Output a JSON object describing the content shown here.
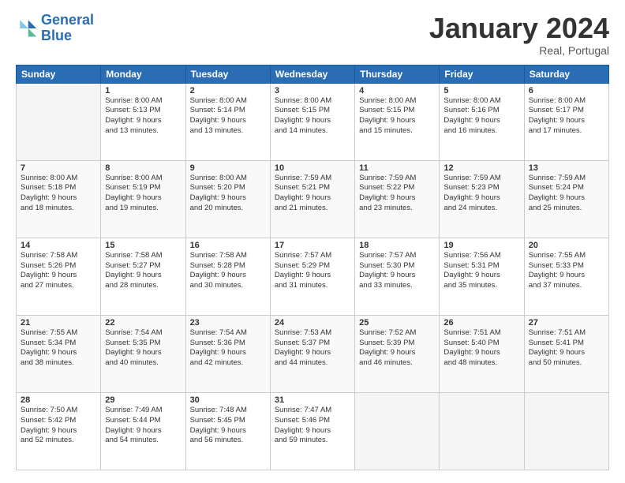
{
  "logo": {
    "line1": "General",
    "line2": "Blue"
  },
  "header": {
    "month": "January 2024",
    "location": "Real, Portugal"
  },
  "weekdays": [
    "Sunday",
    "Monday",
    "Tuesday",
    "Wednesday",
    "Thursday",
    "Friday",
    "Saturday"
  ],
  "weeks": [
    [
      {
        "day": "",
        "info": ""
      },
      {
        "day": "1",
        "info": "Sunrise: 8:00 AM\nSunset: 5:13 PM\nDaylight: 9 hours\nand 13 minutes."
      },
      {
        "day": "2",
        "info": "Sunrise: 8:00 AM\nSunset: 5:14 PM\nDaylight: 9 hours\nand 13 minutes."
      },
      {
        "day": "3",
        "info": "Sunrise: 8:00 AM\nSunset: 5:15 PM\nDaylight: 9 hours\nand 14 minutes."
      },
      {
        "day": "4",
        "info": "Sunrise: 8:00 AM\nSunset: 5:15 PM\nDaylight: 9 hours\nand 15 minutes."
      },
      {
        "day": "5",
        "info": "Sunrise: 8:00 AM\nSunset: 5:16 PM\nDaylight: 9 hours\nand 16 minutes."
      },
      {
        "day": "6",
        "info": "Sunrise: 8:00 AM\nSunset: 5:17 PM\nDaylight: 9 hours\nand 17 minutes."
      }
    ],
    [
      {
        "day": "7",
        "info": "Sunrise: 8:00 AM\nSunset: 5:18 PM\nDaylight: 9 hours\nand 18 minutes."
      },
      {
        "day": "8",
        "info": "Sunrise: 8:00 AM\nSunset: 5:19 PM\nDaylight: 9 hours\nand 19 minutes."
      },
      {
        "day": "9",
        "info": "Sunrise: 8:00 AM\nSunset: 5:20 PM\nDaylight: 9 hours\nand 20 minutes."
      },
      {
        "day": "10",
        "info": "Sunrise: 7:59 AM\nSunset: 5:21 PM\nDaylight: 9 hours\nand 21 minutes."
      },
      {
        "day": "11",
        "info": "Sunrise: 7:59 AM\nSunset: 5:22 PM\nDaylight: 9 hours\nand 23 minutes."
      },
      {
        "day": "12",
        "info": "Sunrise: 7:59 AM\nSunset: 5:23 PM\nDaylight: 9 hours\nand 24 minutes."
      },
      {
        "day": "13",
        "info": "Sunrise: 7:59 AM\nSunset: 5:24 PM\nDaylight: 9 hours\nand 25 minutes."
      }
    ],
    [
      {
        "day": "14",
        "info": "Sunrise: 7:58 AM\nSunset: 5:26 PM\nDaylight: 9 hours\nand 27 minutes."
      },
      {
        "day": "15",
        "info": "Sunrise: 7:58 AM\nSunset: 5:27 PM\nDaylight: 9 hours\nand 28 minutes."
      },
      {
        "day": "16",
        "info": "Sunrise: 7:58 AM\nSunset: 5:28 PM\nDaylight: 9 hours\nand 30 minutes."
      },
      {
        "day": "17",
        "info": "Sunrise: 7:57 AM\nSunset: 5:29 PM\nDaylight: 9 hours\nand 31 minutes."
      },
      {
        "day": "18",
        "info": "Sunrise: 7:57 AM\nSunset: 5:30 PM\nDaylight: 9 hours\nand 33 minutes."
      },
      {
        "day": "19",
        "info": "Sunrise: 7:56 AM\nSunset: 5:31 PM\nDaylight: 9 hours\nand 35 minutes."
      },
      {
        "day": "20",
        "info": "Sunrise: 7:55 AM\nSunset: 5:33 PM\nDaylight: 9 hours\nand 37 minutes."
      }
    ],
    [
      {
        "day": "21",
        "info": "Sunrise: 7:55 AM\nSunset: 5:34 PM\nDaylight: 9 hours\nand 38 minutes."
      },
      {
        "day": "22",
        "info": "Sunrise: 7:54 AM\nSunset: 5:35 PM\nDaylight: 9 hours\nand 40 minutes."
      },
      {
        "day": "23",
        "info": "Sunrise: 7:54 AM\nSunset: 5:36 PM\nDaylight: 9 hours\nand 42 minutes."
      },
      {
        "day": "24",
        "info": "Sunrise: 7:53 AM\nSunset: 5:37 PM\nDaylight: 9 hours\nand 44 minutes."
      },
      {
        "day": "25",
        "info": "Sunrise: 7:52 AM\nSunset: 5:39 PM\nDaylight: 9 hours\nand 46 minutes."
      },
      {
        "day": "26",
        "info": "Sunrise: 7:51 AM\nSunset: 5:40 PM\nDaylight: 9 hours\nand 48 minutes."
      },
      {
        "day": "27",
        "info": "Sunrise: 7:51 AM\nSunset: 5:41 PM\nDaylight: 9 hours\nand 50 minutes."
      }
    ],
    [
      {
        "day": "28",
        "info": "Sunrise: 7:50 AM\nSunset: 5:42 PM\nDaylight: 9 hours\nand 52 minutes."
      },
      {
        "day": "29",
        "info": "Sunrise: 7:49 AM\nSunset: 5:44 PM\nDaylight: 9 hours\nand 54 minutes."
      },
      {
        "day": "30",
        "info": "Sunrise: 7:48 AM\nSunset: 5:45 PM\nDaylight: 9 hours\nand 56 minutes."
      },
      {
        "day": "31",
        "info": "Sunrise: 7:47 AM\nSunset: 5:46 PM\nDaylight: 9 hours\nand 59 minutes."
      },
      {
        "day": "",
        "info": ""
      },
      {
        "day": "",
        "info": ""
      },
      {
        "day": "",
        "info": ""
      }
    ]
  ]
}
